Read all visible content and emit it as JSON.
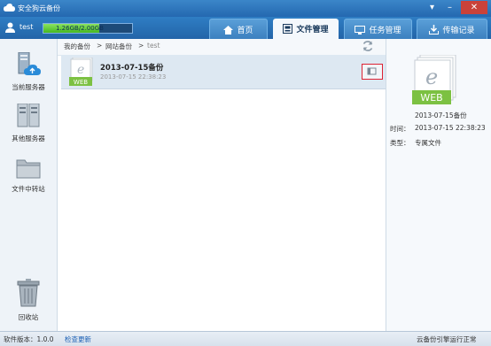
{
  "window": {
    "title": "安全狗云备份",
    "controls": [
      "▾",
      "–",
      "✕"
    ]
  },
  "user": {
    "name": "test",
    "storage_text": "1.26GB/2.00GB",
    "storage_fraction": 0.63
  },
  "tabs": [
    {
      "label": "首页",
      "icon": "home-icon",
      "active": false
    },
    {
      "label": "文件管理",
      "icon": "file-manage-icon",
      "active": true
    },
    {
      "label": "任务管理",
      "icon": "task-icon",
      "active": false
    },
    {
      "label": "传输记录",
      "icon": "transfer-icon",
      "active": false
    }
  ],
  "sidebar": {
    "items": [
      {
        "label": "当前服务器",
        "icon": "current-server-icon"
      },
      {
        "label": "其他服务器",
        "icon": "other-server-icon"
      },
      {
        "label": "文件中转站",
        "icon": "folder-icon"
      },
      {
        "label": "回收站",
        "icon": "trash-icon"
      }
    ]
  },
  "breadcrumb": {
    "items": [
      "我的备份",
      ">",
      "网站备份",
      ">",
      "test"
    ]
  },
  "file": {
    "badge": "WEB",
    "title": "2013-07-15备份",
    "time": "2013-07-15 22:38:23"
  },
  "details": {
    "badge": "WEB",
    "name": "2013-07-15备份",
    "time_label": "时间：",
    "time_value": "2013-07-15 22:38:23",
    "type_label": "类型：",
    "type_value": "专属文件"
  },
  "status": {
    "version": "软件版本：1.0.0",
    "update_link": "检查更新",
    "engine_status": "云备份引擎运行正常"
  },
  "colors": {
    "title_bar": "#2a72b8",
    "accent_green": "#7cc142",
    "link_blue": "#1a5fb4"
  }
}
